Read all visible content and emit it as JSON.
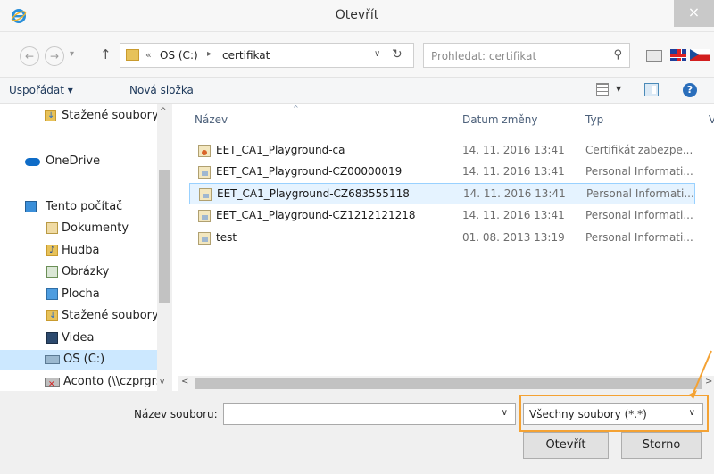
{
  "window": {
    "title": "Otevřít",
    "close_label": "×"
  },
  "nav": {
    "back_label": "←",
    "forward_label": "→",
    "up_label": "↑"
  },
  "address": {
    "chevron": "«",
    "crumbs": [
      "OS (C:)",
      "certifikat"
    ],
    "separator": "▸",
    "refresh_label": "↻"
  },
  "search": {
    "placeholder": "Prohledat: certifikat"
  },
  "toolbar": {
    "organize_label": "Uspořádat ▾",
    "new_folder_label": "Nová složka",
    "help_label": "?"
  },
  "sidebar": {
    "items": [
      {
        "label": "Stažené soubory",
        "icon": "downloads-icon"
      },
      {
        "label": "OneDrive",
        "icon": "cloud-icon"
      },
      {
        "label": "Tento počítač",
        "icon": "computer-icon"
      },
      {
        "label": "Dokumenty",
        "icon": "documents-icon"
      },
      {
        "label": "Hudba",
        "icon": "music-icon"
      },
      {
        "label": "Obrázky",
        "icon": "pictures-icon"
      },
      {
        "label": "Plocha",
        "icon": "desktop-icon"
      },
      {
        "label": "Stažené soubory",
        "icon": "downloads-icon"
      },
      {
        "label": "Videa",
        "icon": "videos-icon"
      },
      {
        "label": "OS (C:)",
        "icon": "drive-icon"
      },
      {
        "label": "Aconto (\\\\czprgrs",
        "icon": "network-drive-icon"
      }
    ],
    "selected": "OS (C:)"
  },
  "filelist": {
    "columns": [
      "Název",
      "Datum změny",
      "Typ",
      "V"
    ],
    "rows": [
      {
        "name": "EET_CA1_Playground-ca",
        "date": "14. 11. 2016 13:41",
        "type": "Certifikát zabezpe...",
        "icon": "certificate-file-icon"
      },
      {
        "name": "EET_CA1_Playground-CZ00000019",
        "date": "14. 11. 2016 13:41",
        "type": "Personal Informati...",
        "icon": "personal-info-file-icon"
      },
      {
        "name": "EET_CA1_Playground-CZ683555118",
        "date": "14. 11. 2016 13:41",
        "type": "Personal Informati...",
        "icon": "personal-info-file-icon"
      },
      {
        "name": "EET_CA1_Playground-CZ1212121218",
        "date": "14. 11. 2016 13:41",
        "type": "Personal Informati...",
        "icon": "personal-info-file-icon"
      },
      {
        "name": "test",
        "date": "01. 08. 2013 13:19",
        "type": "Personal Informati...",
        "icon": "personal-info-file-icon"
      }
    ],
    "selected_row": "EET_CA1_Playground-CZ683555118"
  },
  "bottom": {
    "filename_label": "Název souboru:",
    "filename_value": "",
    "filter_value": "Všechny soubory (*.*)",
    "open_label": "Otevřít",
    "cancel_label": "Storno"
  },
  "colors": {
    "accent": "#0078d7",
    "selection": "#cce8ff",
    "annotation": "#f4a233"
  }
}
